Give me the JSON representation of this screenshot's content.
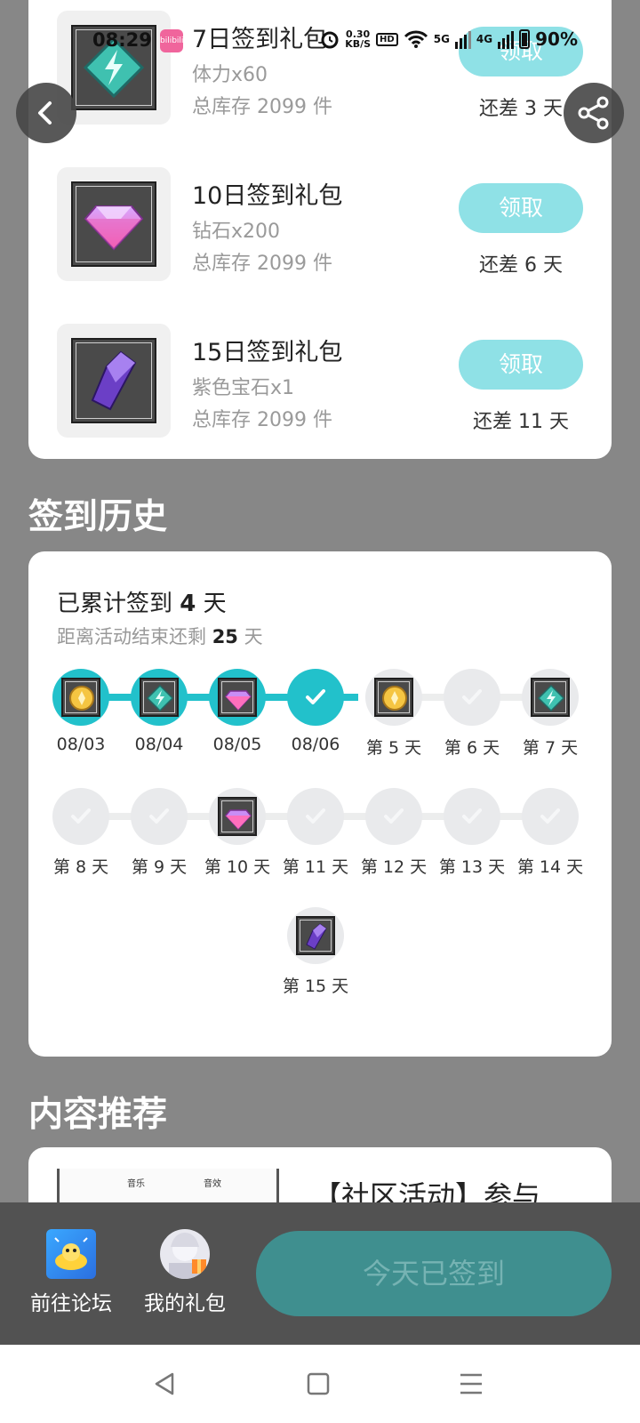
{
  "status": {
    "time": "08:29",
    "app_badge": "bilibili",
    "speed_value": "0.30",
    "speed_unit": "KB/S",
    "hd": "HD",
    "net1": "5G",
    "net2": "4G",
    "battery": "90%"
  },
  "gifts": [
    {
      "title": "7日签到礼包",
      "reward": "体力x60",
      "stock": "总库存 2099 件",
      "button": "领取",
      "remain": "还差 3 天",
      "icon": "lightning-gem-icon"
    },
    {
      "title": "10日签到礼包",
      "reward": "钻石x200",
      "stock": "总库存 2099 件",
      "button": "领取",
      "remain": "还差 6 天",
      "icon": "diamond-icon"
    },
    {
      "title": "15日签到礼包",
      "reward": "紫色宝石x1",
      "stock": "总库存 2099 件",
      "button": "领取",
      "remain": "还差 11 天",
      "icon": "purple-crystal-icon"
    }
  ],
  "history": {
    "section_title": "签到历史",
    "total_prefix": "已累计签到",
    "total_days": "4",
    "total_suffix": "天",
    "remain_prefix": "距离活动结束还剩",
    "remain_days": "25",
    "remain_suffix": "天",
    "days": [
      {
        "label": "08/03",
        "done": true,
        "icon": "gold-coin-icon"
      },
      {
        "label": "08/04",
        "done": true,
        "icon": "lightning-gem-icon"
      },
      {
        "label": "08/05",
        "done": true,
        "icon": "diamond-icon"
      },
      {
        "label": "08/06",
        "done": true,
        "icon": "check-icon"
      },
      {
        "label": "第 5 天",
        "done": false,
        "icon": "gold-coin-icon"
      },
      {
        "label": "第 6 天",
        "done": false,
        "icon": "check-icon"
      },
      {
        "label": "第 7 天",
        "done": false,
        "icon": "lightning-gem-icon"
      },
      {
        "label": "第 8 天",
        "done": false,
        "icon": "check-icon"
      },
      {
        "label": "第 9 天",
        "done": false,
        "icon": "check-icon"
      },
      {
        "label": "第 10 天",
        "done": false,
        "icon": "diamond-icon"
      },
      {
        "label": "第 11 天",
        "done": false,
        "icon": "check-icon"
      },
      {
        "label": "第 12 天",
        "done": false,
        "icon": "check-icon"
      },
      {
        "label": "第 13 天",
        "done": false,
        "icon": "check-icon"
      },
      {
        "label": "第 14 天",
        "done": false,
        "icon": "check-icon"
      },
      {
        "label": "第 15 天",
        "done": false,
        "icon": "purple-crystal-icon"
      }
    ]
  },
  "recommend": {
    "section_title": "内容推荐",
    "item_text": "【社区活动】参与",
    "thumb_label_1": "音乐",
    "thumb_label_2": "音效"
  },
  "bottom": {
    "forum_label": "前往论坛",
    "gifts_label": "我的礼包",
    "checkin_button": "今天已签到"
  },
  "colors": {
    "accent": "#22c1cb",
    "button_light": "#8fe1e6",
    "checked_button": "#3f8f8f",
    "overlay": "#878787"
  }
}
